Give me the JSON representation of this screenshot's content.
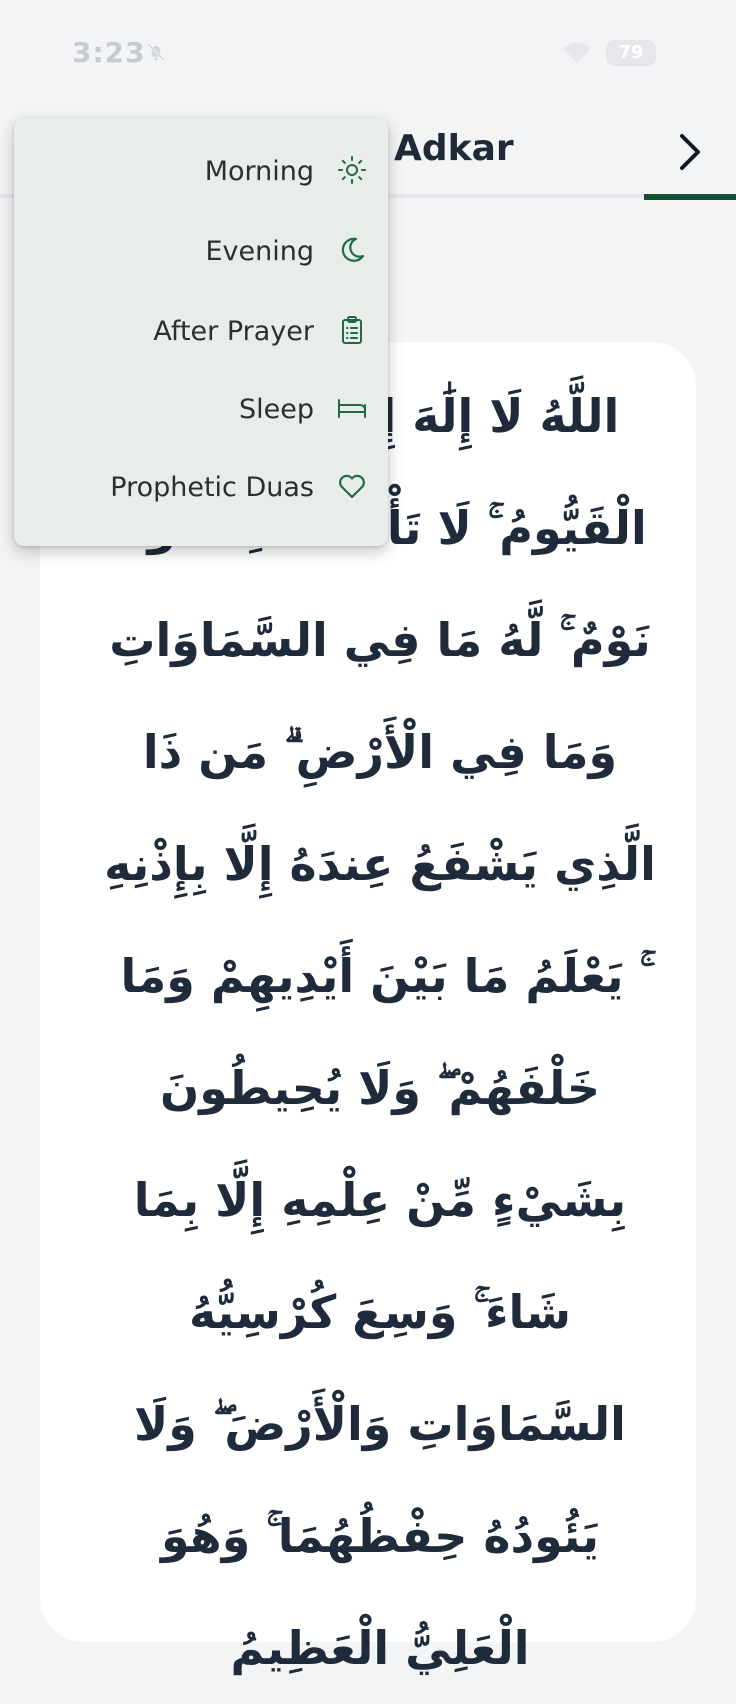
{
  "status_bar": {
    "time": "3:23",
    "battery": "79"
  },
  "header": {
    "title": "Adkar"
  },
  "menu": {
    "items": [
      {
        "label": "Morning",
        "icon": "sun-icon"
      },
      {
        "label": "Evening",
        "icon": "moon-icon"
      },
      {
        "label": "After Prayer",
        "icon": "clipboard-list-icon"
      },
      {
        "label": "Sleep",
        "icon": "bed-icon"
      },
      {
        "label": "Prophetic Duas",
        "icon": "heart-icon"
      }
    ]
  },
  "content": {
    "arabic_text": "اللَّهُ لَا إِلَٰهَ إِلَّا هُوَ الْحَيُّ الْقَيُّومُ ۚ لَا تَأْخُذُهُ سِنَةٌ وَلَا نَوْمٌ ۚ لَّهُ مَا فِي السَّمَاوَاتِ وَمَا فِي الْأَرْضِ ۗ مَن ذَا الَّذِي يَشْفَعُ عِندَهُ إِلَّا بِإِذْنِهِ ۚ يَعْلَمُ مَا بَيْنَ أَيْدِيهِمْ وَمَا خَلْفَهُمْ ۖ وَلَا يُحِيطُونَ بِشَيْءٍ مِّنْ عِلْمِهِ إِلَّا بِمَا شَاءَ ۚ وَسِعَ كُرْسِيُّهُ السَّمَاوَاتِ وَالْأَرْضَ ۖ وَلَا يَئُودُهُ حِفْظُهُمَا ۚ وَهُوَ الْعَلِيُّ الْعَظِيمُ"
  },
  "colors": {
    "accent": "#0f5132",
    "icon": "#1f6b47",
    "menu_bg": "#e8ede9",
    "page_bg": "#f3f4f6"
  }
}
